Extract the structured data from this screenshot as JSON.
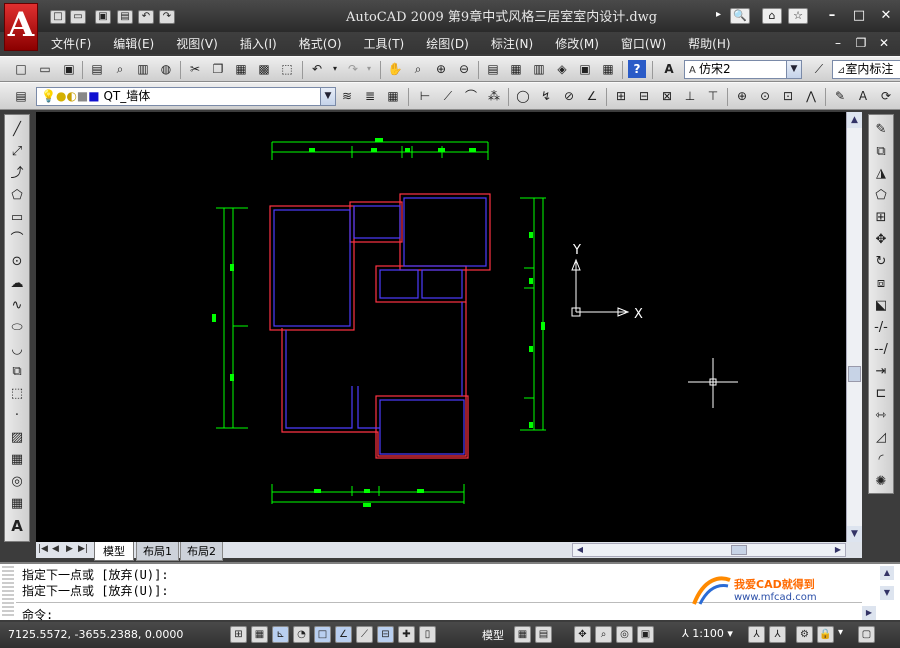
{
  "window": {
    "title": "AutoCAD 2009  第9章中式风格三居室室内设计.dwg",
    "logo_letter": "A"
  },
  "menu": [
    "文件(F)",
    "编辑(E)",
    "视图(V)",
    "插入(I)",
    "格式(O)",
    "工具(T)",
    "绘图(D)",
    "标注(N)",
    "修改(M)",
    "窗口(W)",
    "帮助(H)"
  ],
  "toolbar": {
    "text_style": "仿宋2",
    "dim_style": "室内标注",
    "layer": "QT_墙体"
  },
  "tabs": [
    "模型",
    "布局1",
    "布局2"
  ],
  "command": {
    "history": [
      "指定下一点或 [放弃(U)]:",
      "指定下一点或 [放弃(U)]:"
    ],
    "prompt": "命令:"
  },
  "watermark": {
    "title": "我爱CAD就得到",
    "url": "www.mfcad.com"
  },
  "status": {
    "coords": "7125.5572,  -3655.2388, 0.0000",
    "space_label": "模型",
    "scale": "1:100"
  },
  "ucs": {
    "x_label": "X",
    "y_label": "Y"
  },
  "colors": {
    "canvas": "#000000",
    "wall_outer": "#ff3344",
    "wall_inner": "#4d3cff",
    "dimension": "#00ff00"
  }
}
